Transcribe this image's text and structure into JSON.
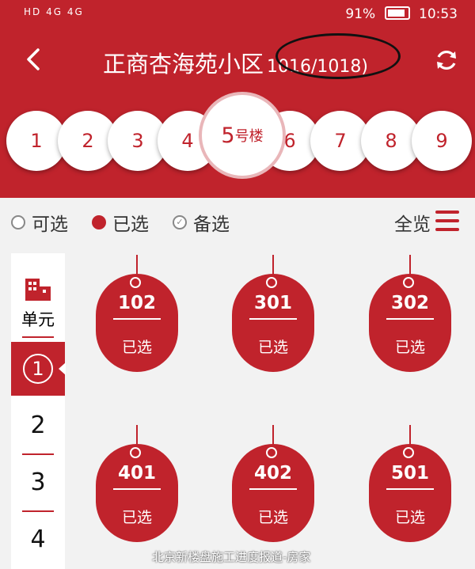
{
  "status_bar": {
    "network": "HD 4G 4G",
    "battery": "91%",
    "time": "10:53"
  },
  "header": {
    "title": "正商杏海苑小区",
    "count": "1016/1018)"
  },
  "buildings": [
    {
      "label": "1"
    },
    {
      "label": "2"
    },
    {
      "label": "3"
    },
    {
      "label": "4"
    },
    {
      "label": "5",
      "suffix": "号楼",
      "selected": true
    },
    {
      "label": "6"
    },
    {
      "label": "7"
    },
    {
      "label": "8"
    },
    {
      "label": "9"
    }
  ],
  "legend": {
    "available": "可选",
    "selected": "已选",
    "backup": "备选",
    "overview": "全览"
  },
  "units": {
    "title": "单元",
    "current": "1",
    "items": [
      "2",
      "3",
      "4"
    ]
  },
  "rooms": [
    {
      "number": "102",
      "status": "已选"
    },
    {
      "number": "301",
      "status": "已选"
    },
    {
      "number": "302",
      "status": "已选"
    },
    {
      "number": "401",
      "status": "已选"
    },
    {
      "number": "402",
      "status": "已选"
    },
    {
      "number": "501",
      "status": "已选"
    }
  ],
  "watermark": "北京新楼盘施工进度报道-房家",
  "colors": {
    "brand": "#c0232c",
    "background": "#f2f2f2"
  }
}
